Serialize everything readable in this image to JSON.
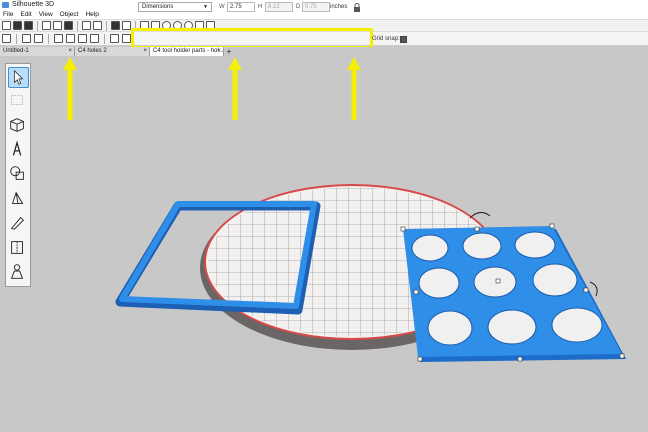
{
  "window": {
    "title": "Silhouette 3D"
  },
  "menu": [
    "File",
    "Edit",
    "View",
    "Object",
    "Help"
  ],
  "dimensions": {
    "mode": "Dimensions",
    "w_label": "W",
    "w_value": "2.75",
    "h_label": "H",
    "h_value": "8.12",
    "d_label": "D",
    "d_value": "0.75",
    "units": "inches"
  },
  "grid_snap_label": "Grid snap:",
  "tabs": [
    {
      "label": "Untitled-1"
    },
    {
      "label": "C4 holes 2"
    },
    {
      "label": "C4 tool holder parts - hol..."
    }
  ],
  "tools": [
    "select-tool",
    "align-tool",
    "cube-tool",
    "text-tool",
    "shapes-tool",
    "extrude-tool",
    "knife-tool",
    "mirror-tool",
    "figure-tool"
  ],
  "colors": {
    "highlight": "#f5f003",
    "accent_blue": "#2f8ee8",
    "plate_ring": "#6b6666"
  }
}
